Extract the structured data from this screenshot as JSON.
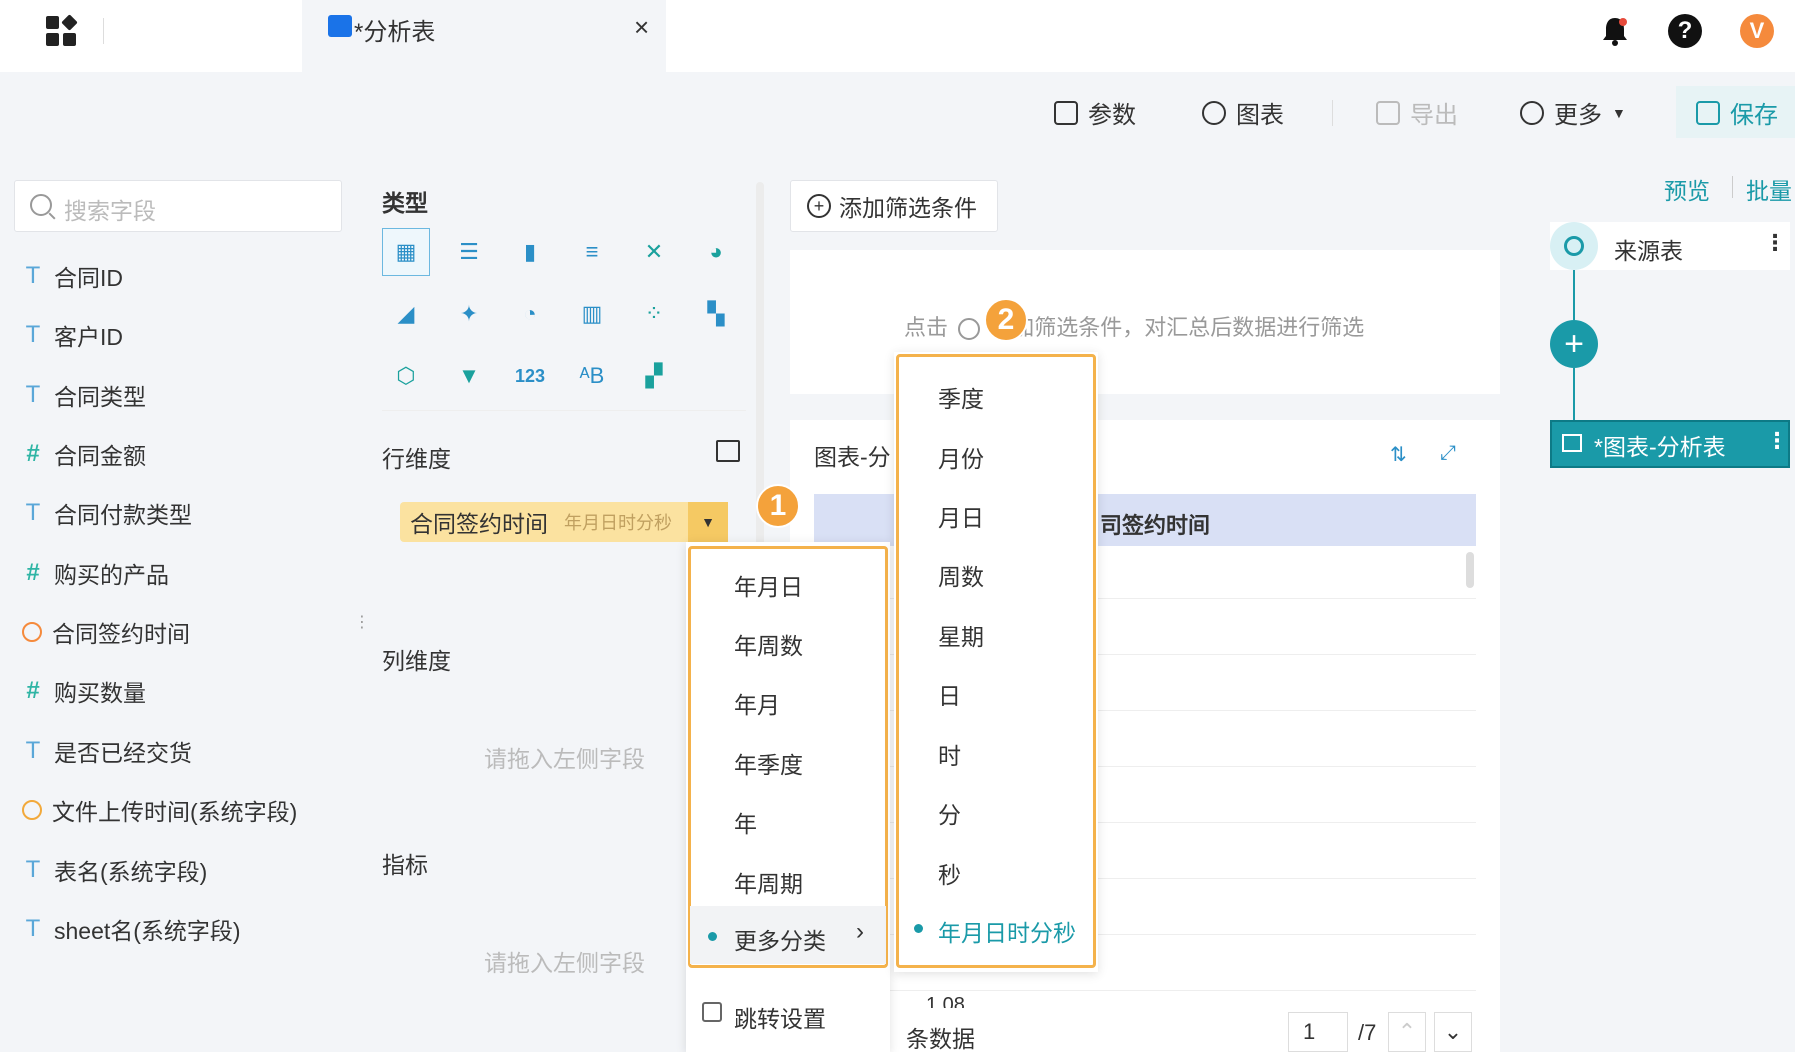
{
  "tab": {
    "title": "*分析表",
    "close": "×"
  },
  "topbar": {
    "avatar_letter": "V",
    "help_glyph": "?"
  },
  "toolbar": {
    "params": "参数",
    "chart": "图表",
    "export": "导出",
    "more": "更多",
    "save": "保存"
  },
  "fields_panel": {
    "search_placeholder": "搜索字段",
    "fields": [
      {
        "type": "T",
        "label": "合同ID"
      },
      {
        "type": "T",
        "label": "客户ID"
      },
      {
        "type": "T",
        "label": "合同类型"
      },
      {
        "type": "#",
        "label": "合同金额"
      },
      {
        "type": "T",
        "label": "合同付款类型"
      },
      {
        "type": "#",
        "label": "购买的产品"
      },
      {
        "type": "time",
        "label": "合同签约时间"
      },
      {
        "type": "#",
        "label": "购买数量"
      },
      {
        "type": "T",
        "label": "是否已经交货"
      },
      {
        "type": "time",
        "label": "文件上传时间(系统字段)"
      },
      {
        "type": "T",
        "label": "表名(系统字段)"
      },
      {
        "type": "T",
        "label": "sheet名(系统字段)"
      }
    ]
  },
  "config_panel": {
    "type_title": "类型",
    "row_dim": "行维度",
    "col_dim": "列维度",
    "metric": "指标",
    "drop_hint": "请拖入左侧字段",
    "chip_label": "合同签约时间",
    "chip_sub": "年月日时分秒",
    "chart_types": [
      "table-icon",
      "detail-table-icon",
      "bar-chart-icon",
      "horizontal-bar-icon",
      "combo-chart-icon",
      "pie-chart-icon",
      "area-chart-icon",
      "map-icon",
      "gauge-icon",
      "stacked-bar-icon",
      "scatter-icon",
      "cards-icon",
      "radar-icon",
      "funnel-icon",
      "kpi-number-icon",
      "word-cloud-icon",
      "heatmap-icon"
    ]
  },
  "preview": {
    "add_filter": "添加筛选条件",
    "filter_hint_prefix": "点击",
    "filter_hint_suffix": "加筛选条件，对汇总后数据进行筛选",
    "card_title": "图表-分",
    "header_col": "司签约时间",
    "partial_value": "1 08",
    "footer": "条数据",
    "page": "1",
    "page_total": "/7"
  },
  "flow": {
    "preview": "预览",
    "batch": "批量",
    "source": "来源表",
    "chart_node": "*图表-分析表"
  },
  "menu1": {
    "items": [
      "年月日",
      "年周数",
      "年月",
      "年季度",
      "年",
      "年周期"
    ],
    "more": "更多分类",
    "jump": "跳转设置"
  },
  "menu2": {
    "items": [
      "季度",
      "月份",
      "月日",
      "周数",
      "星期",
      "日",
      "时",
      "分",
      "秒"
    ],
    "active": "年月日时分秒"
  },
  "badges": {
    "one": "1",
    "two": "2"
  },
  "colors": {
    "accent": "#1a9aa8",
    "highlight": "#f4b24b",
    "chip": "#fbe2a0"
  }
}
